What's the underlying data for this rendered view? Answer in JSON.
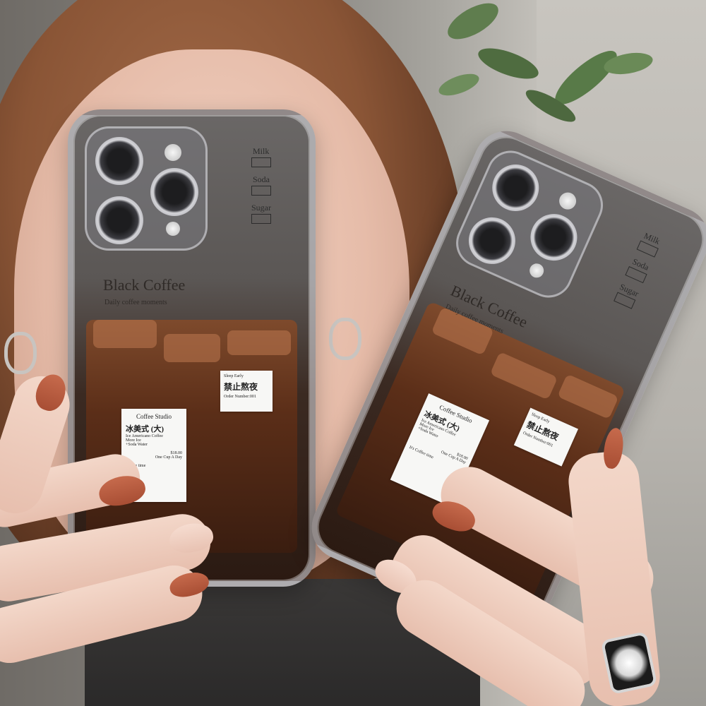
{
  "scene": {
    "description_tag": "product-photo",
    "colors": {
      "coffee": "#5b2e18",
      "nail": "#b85a3d",
      "case_frame": "#e6e6eb"
    }
  },
  "phone_left": {
    "brand": "Black Coffee",
    "subtitle": "Daily coffee moments",
    "checkboxes": [
      "Milk",
      "Soda",
      "Sugar"
    ],
    "label_main": {
      "title": "Coffee Studio",
      "cn_line": "冰美式  (大)",
      "line2": "Ice Americano Coffee",
      "line3": "More Ice",
      "line4": "+Soda Water",
      "price": "$18.00",
      "line5": "One Cup A Day",
      "footer": "Coffee time"
    },
    "label_small": {
      "line1": "Sleep Early",
      "cn_line": "禁止熬夜",
      "line2": "Order Number:001"
    }
  },
  "phone_right": {
    "brand": "Black Coffee",
    "subtitle": "Daily coffee moments",
    "checkboxes": [
      "Milk",
      "Soda",
      "Sugar"
    ],
    "label_main": {
      "title": "Coffee Studio",
      "cn_line": "冰美式  (大)",
      "line2": "Ice Americano Coffee",
      "line3": "More Ice",
      "line4": "+Soda Water",
      "price": "$18.00",
      "line5": "One Cup A Day",
      "footer": "It's Coffee time"
    },
    "label_small": {
      "line1": "Sleep Early",
      "cn_line": "禁止熬夜",
      "line2": "Order Number:001"
    }
  }
}
